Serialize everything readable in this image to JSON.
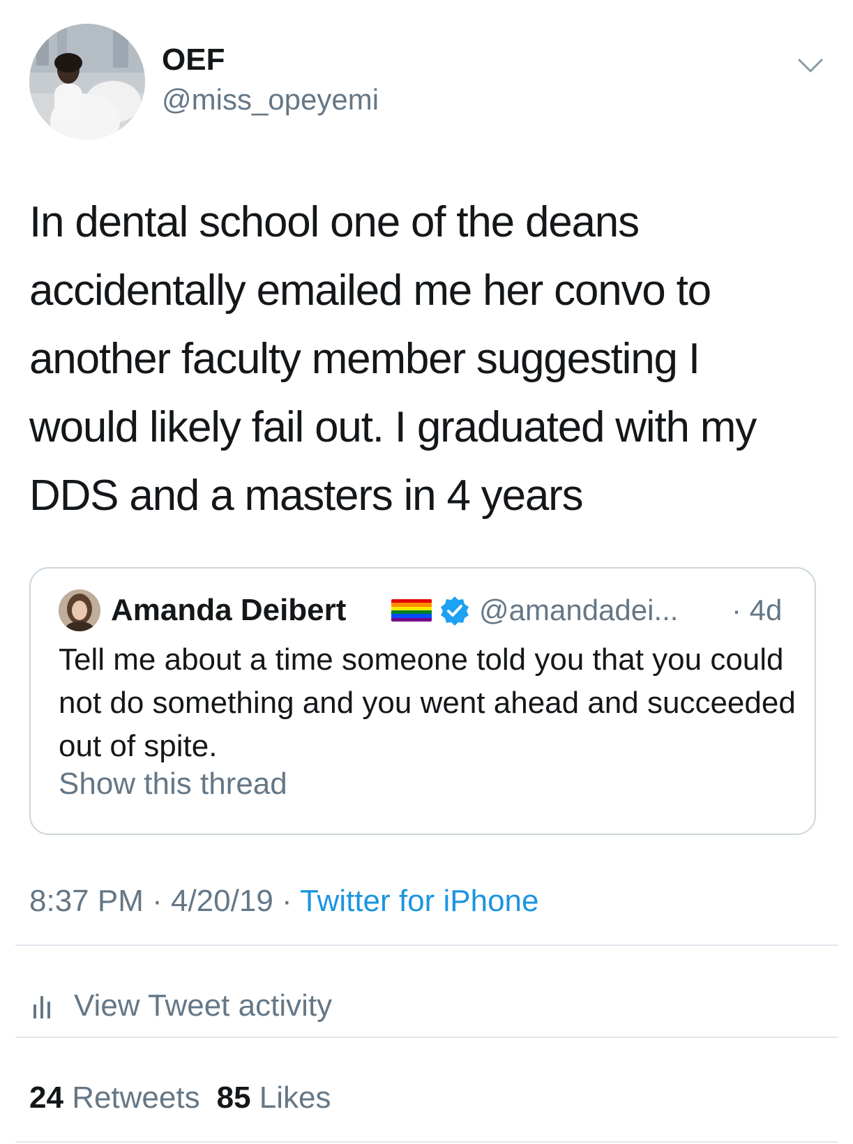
{
  "tweet": {
    "author_name": "OEF",
    "author_handle": "@miss_opeyemi",
    "text": "In dental school one of the deans\naccidentally emailed me her convo to\nanother faculty member suggesting I\nwould likely fail out. I graduated with my\nDDS and a masters in 4 years",
    "time": "8:37 PM",
    "date": "4/20/19",
    "source": "Twitter for iPhone",
    "separator": " · "
  },
  "quote": {
    "author_name": "Amanda Deibert",
    "author_handle": "@amandadei...",
    "age": "· 4d",
    "text": "Tell me about a time someone told you that you could not do something and you went ahead and succeeded out of spite.",
    "show_thread": "Show this thread"
  },
  "activity": {
    "label": "View Tweet activity"
  },
  "stats": {
    "retweets_count": "24",
    "retweets_label": "Retweets",
    "likes_count": "85",
    "likes_label": "Likes"
  },
  "icons": {
    "menu": "chevron-down-icon",
    "verified": "verified-badge-icon",
    "flag": "rainbow-flag-icon",
    "activity": "bar-chart-icon"
  },
  "colors": {
    "text": "#14171a",
    "secondary": "#657786",
    "link": "#1b95e0",
    "border": "#ccd6dd",
    "divider": "#e1e8ed",
    "verified": "#1da1f2"
  }
}
